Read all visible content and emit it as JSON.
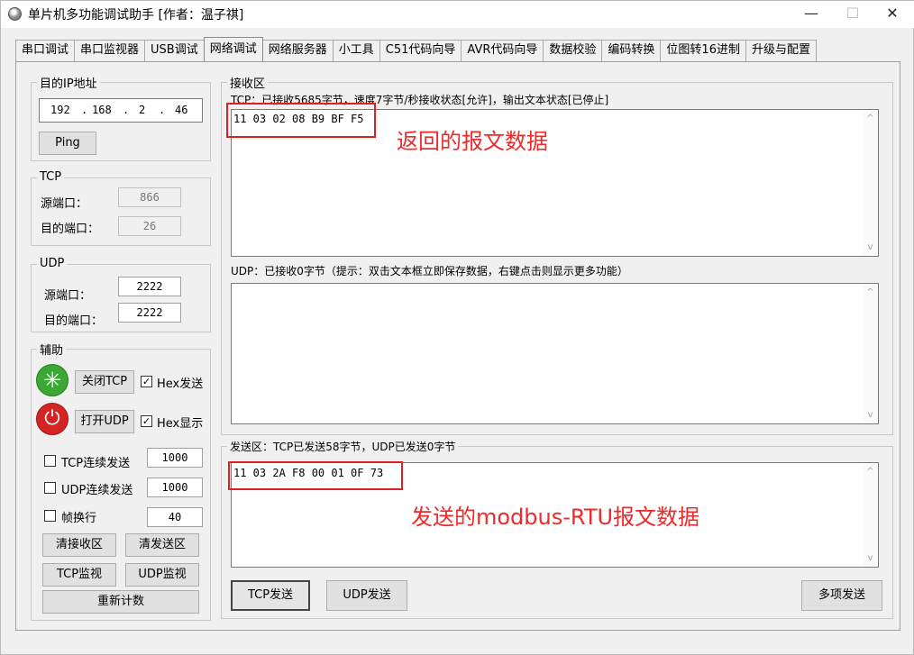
{
  "window": {
    "title": "单片机多功能调试助手 [作者：温子祺]",
    "minimize": "—",
    "maximize": "☐",
    "close": "✕"
  },
  "tabs": [
    "串口调试",
    "串口监视器",
    "USB调试",
    "网络调试",
    "网络服务器",
    "小工具",
    "C51代码向导",
    "AVR代码向导",
    "数据校验",
    "编码转换",
    "位图转16进制",
    "升级与配置"
  ],
  "left": {
    "target_ip_title": "目的IP地址",
    "ip": [
      "192",
      "168",
      "2",
      "46"
    ],
    "ip_dot": ".",
    "ping": "Ping",
    "tcp_title": "TCP",
    "tcp_src_label": "源端口：",
    "tcp_src": "866",
    "tcp_dst_label": "目的端口：",
    "tcp_dst": "26",
    "udp_title": "UDP",
    "udp_src_label": "源端口：",
    "udp_src": "2222",
    "udp_dst_label": "目的端口：",
    "udp_dst": "2222",
    "aux_title": "辅助",
    "close_tcp": "关闭TCP",
    "hex_send": "Hex发送",
    "hex_send_checked": "✓",
    "open_udp": "打开UDP",
    "hex_show": "Hex显示",
    "hex_show_checked": "✓",
    "tcp_cont": "TCP连续发送",
    "tcp_cont_val": "1000",
    "udp_cont": "UDP连续发送",
    "udp_cont_val": "1000",
    "frame_wrap": "帧换行",
    "frame_wrap_val": "40",
    "clear_recv": "清接收区",
    "clear_send": "清发送区",
    "tcp_monitor": "TCP监视",
    "udp_monitor": "UDP监视",
    "recount": "重新计数"
  },
  "receive": {
    "title": "接收区",
    "tcp_status": "TCP：已接收5685字节，速度7字节/秒接收状态[允许]，输出文本状态[已停止]",
    "tcp_data": "11 03 02 08 B9 BF F5",
    "udp_status": "UDP：已接收0字节（提示：双击文本框立即保存数据，右键点击则显示更多功能）"
  },
  "send": {
    "title": "发送区：TCP已发送58字节，UDP已发送0字节",
    "data": "11 03 2A F8 00 01 0F 73",
    "tcp_send": "TCP发送",
    "udp_send": "UDP发送",
    "multi_send": "多项发送"
  },
  "annotations": {
    "received": "返回的报文数据",
    "sent": "发送的modbus-RTU报文数据"
  },
  "icons": {
    "scroll_up": "^",
    "scroll_down": "v",
    "green_icon": "✳",
    "red_icon": "⏻"
  },
  "colors": {
    "annotation": "#ee2a2a",
    "green_icon": "#3aa832",
    "red_icon": "#d42424"
  }
}
